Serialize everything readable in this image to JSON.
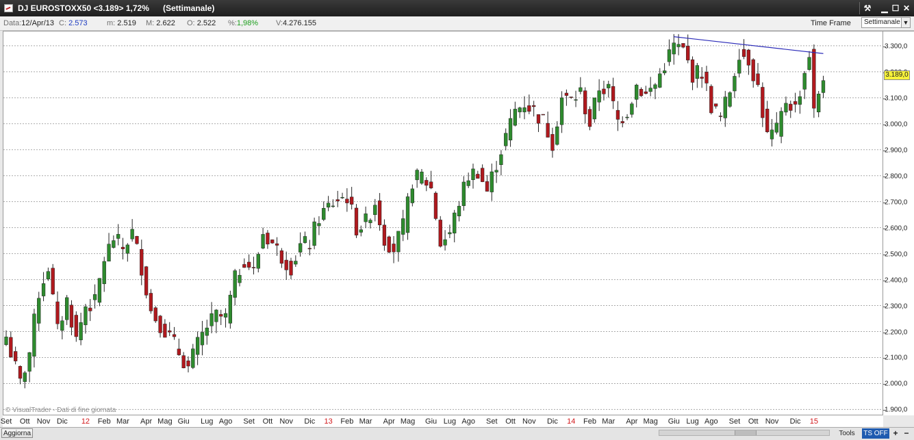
{
  "window": {
    "title": "DJ EUROSTOXX50 <3.189> 1,72%",
    "timeframe_title": "(Settimanale)",
    "buttons": {
      "tool": "⚒",
      "minimize": "▁",
      "restore": "☐",
      "close": "✕"
    }
  },
  "info": {
    "data_label": "Data:",
    "data_value": "12/Apr/13",
    "c_label": "C:",
    "c_value": "2.573",
    "m_label": "m:",
    "m_value": "2.519",
    "M_label": "M:",
    "M_value": "2.622",
    "o_label": "O:",
    "o_value": "2.522",
    "pct_label": "%:",
    "pct_value": "1,98%",
    "v_label": "V:",
    "v_value": "4.276.155",
    "timeframe_label": "Time Frame",
    "timeframe_value": "Settimanale"
  },
  "chart": {
    "last_price": "3.189,0",
    "watermark": "© VisualTrader - Dati di fine giornata",
    "colors": {
      "up": "#2e8b2e",
      "down": "#b0191e",
      "trendline": "#2a2ab8",
      "grid": "#a8a8a8"
    }
  },
  "chart_data": {
    "type": "candlestick",
    "y_ticks": [
      "1.900,0",
      "2.000,0",
      "2.100,0",
      "2.200,0",
      "2.300,0",
      "2.400,0",
      "2.500,0",
      "2.600,0",
      "2.700,0",
      "2.800,0",
      "2.900,0",
      "3.000,0",
      "3.100,0",
      "3.200,0",
      "3.300,0"
    ],
    "ylim": [
      1880,
      3355
    ],
    "x_labels": [
      {
        "t": "Set",
        "i": 0,
        "year": false
      },
      {
        "t": "Ott",
        "i": 4,
        "year": false
      },
      {
        "t": "Nov",
        "i": 8,
        "year": false
      },
      {
        "t": "Dic",
        "i": 12,
        "year": false
      },
      {
        "t": "12",
        "i": 17,
        "year": true
      },
      {
        "t": "Feb",
        "i": 21,
        "year": false
      },
      {
        "t": "Mar",
        "i": 25,
        "year": false
      },
      {
        "t": "Apr",
        "i": 30,
        "year": false
      },
      {
        "t": "Mag",
        "i": 34,
        "year": false
      },
      {
        "t": "Giu",
        "i": 38,
        "year": false
      },
      {
        "t": "Lug",
        "i": 43,
        "year": false
      },
      {
        "t": "Ago",
        "i": 47,
        "year": false
      },
      {
        "t": "Set",
        "i": 52,
        "year": false
      },
      {
        "t": "Ott",
        "i": 56,
        "year": false
      },
      {
        "t": "Nov",
        "i": 60,
        "year": false
      },
      {
        "t": "Dic",
        "i": 65,
        "year": false
      },
      {
        "t": "13",
        "i": 69,
        "year": true
      },
      {
        "t": "Feb",
        "i": 73,
        "year": false
      },
      {
        "t": "Mar",
        "i": 77,
        "year": false
      },
      {
        "t": "Apr",
        "i": 82,
        "year": false
      },
      {
        "t": "Mag",
        "i": 86,
        "year": false
      },
      {
        "t": "Giu",
        "i": 91,
        "year": false
      },
      {
        "t": "Lug",
        "i": 95,
        "year": false
      },
      {
        "t": "Ago",
        "i": 99,
        "year": false
      },
      {
        "t": "Set",
        "i": 104,
        "year": false
      },
      {
        "t": "Ott",
        "i": 108,
        "year": false
      },
      {
        "t": "Nov",
        "i": 112,
        "year": false
      },
      {
        "t": "Dic",
        "i": 117,
        "year": false
      },
      {
        "t": "14",
        "i": 121,
        "year": true
      },
      {
        "t": "Feb",
        "i": 125,
        "year": false
      },
      {
        "t": "Mar",
        "i": 129,
        "year": false
      },
      {
        "t": "Apr",
        "i": 134,
        "year": false
      },
      {
        "t": "Mag",
        "i": 138,
        "year": false
      },
      {
        "t": "Giu",
        "i": 143,
        "year": false
      },
      {
        "t": "Lug",
        "i": 147,
        "year": false
      },
      {
        "t": "Ago",
        "i": 151,
        "year": false
      },
      {
        "t": "Set",
        "i": 156,
        "year": false
      },
      {
        "t": "Ott",
        "i": 160,
        "year": false
      },
      {
        "t": "Nov",
        "i": 164,
        "year": false
      },
      {
        "t": "Dic",
        "i": 169,
        "year": false
      },
      {
        "t": "15",
        "i": 173,
        "year": true
      }
    ],
    "anchors": [
      [
        0,
        2180
      ],
      [
        3,
        2000
      ],
      [
        5,
        2120
      ],
      [
        7,
        2350
      ],
      [
        9,
        2450
      ],
      [
        11,
        2200
      ],
      [
        13,
        2320
      ],
      [
        15,
        2170
      ],
      [
        17,
        2300
      ],
      [
        19,
        2310
      ],
      [
        21,
        2480
      ],
      [
        23,
        2560
      ],
      [
        25,
        2520
      ],
      [
        27,
        2580
      ],
      [
        29,
        2450
      ],
      [
        31,
        2280
      ],
      [
        33,
        2230
      ],
      [
        35,
        2180
      ],
      [
        37,
        2120
      ],
      [
        39,
        2060
      ],
      [
        41,
        2150
      ],
      [
        43,
        2220
      ],
      [
        45,
        2260
      ],
      [
        47,
        2250
      ],
      [
        49,
        2400
      ],
      [
        51,
        2480
      ],
      [
        53,
        2430
      ],
      [
        55,
        2580
      ],
      [
        57,
        2540
      ],
      [
        59,
        2490
      ],
      [
        61,
        2450
      ],
      [
        63,
        2530
      ],
      [
        65,
        2540
      ],
      [
        67,
        2640
      ],
      [
        69,
        2680
      ],
      [
        71,
        2710
      ],
      [
        73,
        2720
      ],
      [
        75,
        2600
      ],
      [
        77,
        2620
      ],
      [
        79,
        2700
      ],
      [
        81,
        2560
      ],
      [
        83,
        2520
      ],
      [
        85,
        2600
      ],
      [
        87,
        2780
      ],
      [
        89,
        2800
      ],
      [
        91,
        2750
      ],
      [
        93,
        2540
      ],
      [
        95,
        2580
      ],
      [
        97,
        2700
      ],
      [
        99,
        2800
      ],
      [
        101,
        2820
      ],
      [
        103,
        2740
      ],
      [
        105,
        2850
      ],
      [
        107,
        2950
      ],
      [
        109,
        3050
      ],
      [
        111,
        3080
      ],
      [
        113,
        3050
      ],
      [
        115,
        3010
      ],
      [
        117,
        2930
      ],
      [
        119,
        3100
      ],
      [
        121,
        3090
      ],
      [
        123,
        3120
      ],
      [
        125,
        3000
      ],
      [
        127,
        3140
      ],
      [
        129,
        3130
      ],
      [
        131,
        3010
      ],
      [
        133,
        3050
      ],
      [
        135,
        3150
      ],
      [
        137,
        3110
      ],
      [
        139,
        3150
      ],
      [
        141,
        3230
      ],
      [
        143,
        3300
      ],
      [
        145,
        3280
      ],
      [
        147,
        3190
      ],
      [
        149,
        3200
      ],
      [
        151,
        3070
      ],
      [
        153,
        3020
      ],
      [
        155,
        3130
      ],
      [
        157,
        3280
      ],
      [
        159,
        3250
      ],
      [
        161,
        3140
      ],
      [
        163,
        2950
      ],
      [
        165,
        2970
      ],
      [
        167,
        3090
      ],
      [
        169,
        3060
      ],
      [
        171,
        3200
      ],
      [
        172,
        3270
      ],
      [
        173,
        3040
      ],
      [
        174,
        3120
      ],
      [
        175,
        3189
      ]
    ],
    "trendline": [
      [
        143,
        3335
      ],
      [
        175,
        3270
      ]
    ]
  },
  "status": {
    "aggiorna": "Aggiorna",
    "tools": "Tools",
    "ts": "TS OFF",
    "plus": "+",
    "minus": "−"
  }
}
